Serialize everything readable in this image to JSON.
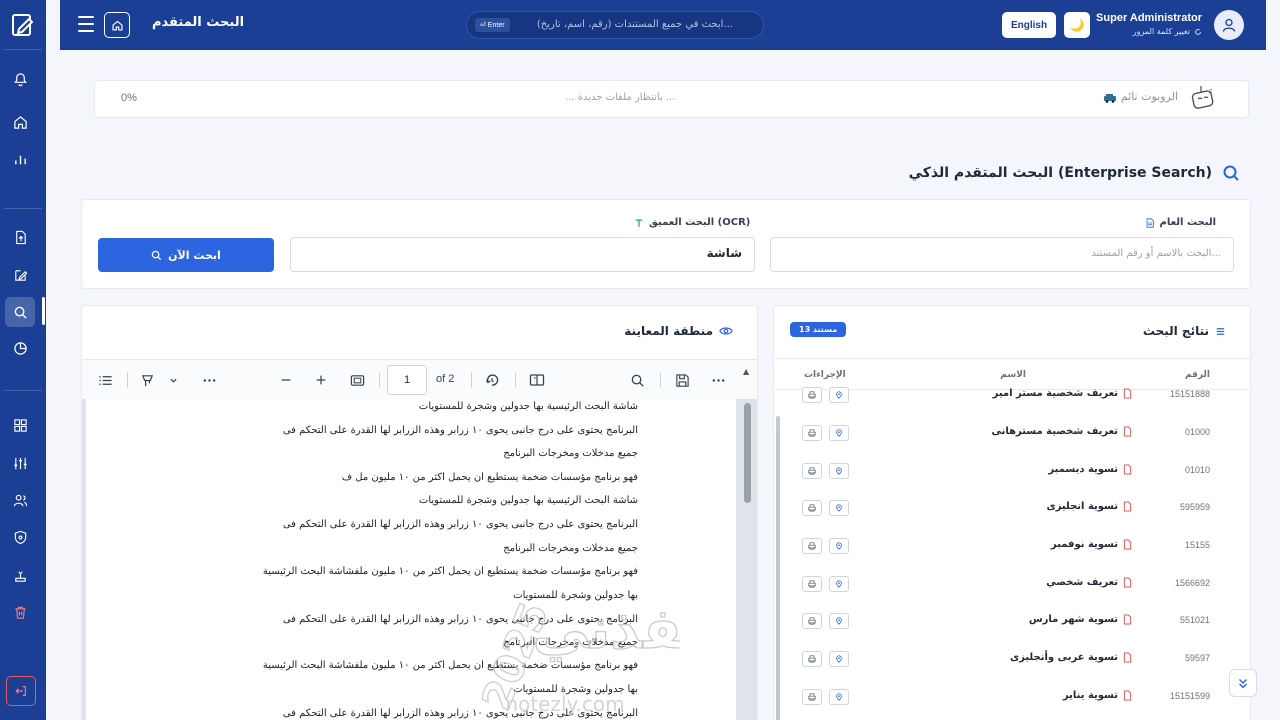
{
  "header": {
    "title": "البحث المتقدم",
    "search_placeholder": "ابحث في جميع المستندات (رقم، اسم، تاريخ)...",
    "enter_key": "⏎ Enter",
    "language_button": "English",
    "user_name": "Super Administrator",
    "change_password": "تغيير كلمة المرور"
  },
  "robot": {
    "status": "الروبوت نائم",
    "waiting_text": "... بانتظار ملفات جديدة ...",
    "progress_percent": "0%"
  },
  "page": {
    "title": "البحث المتقدم الذكي (Enterprise Search)"
  },
  "search": {
    "general_label": "البحث العام",
    "general_placeholder": "البحث بالاسم أو رقم المستند...",
    "deep_label": "البحث العميق (OCR)",
    "deep_value": "شاشة",
    "button_label": "ابحث الآن"
  },
  "preview": {
    "title": "منطقة المعاينة",
    "page_number": "1",
    "page_count_label": "of 2",
    "lines": [
      "شاشة البحث الرئيسية بها جدولين وشجرة للمستويات",
      "البرنامج يحتوى على درج جانبى يحوى ١٠ زرابر وهذه الزرابر لها القدرة على التحكم فى",
      "جميع مدخلات ومخرجات البرنامج",
      "فهو برنامج مؤسسات ضخمة يستطيع ان يحمل اكثر من ١٠ مليون مل ف",
      "شاشة البحث الرئيسية بها جدولين وشجرة للمستويات",
      "البرنامج يحتوى على درج جانبى يحوى ١٠ زرابر وهذه الزرابر لها القدرة على التحكم فى",
      "جميع مدخلات ومخرجات البرنامج",
      "فهو برنامج مؤسسات ضخمة يستطيع ان يحمل اكثر من ١٠ مليون ملفشاشة البحث الرئيسية",
      "بها جدولين وشجرة للمستويات",
      "البرنامج يحتوى على درج جانبى يحوى ١٠ زرابر وهذه الزرابر لها القدرة على التحكم فى",
      "جميع مدخلات ومخرجات البرنامج",
      "فهو برنامج مؤسسات ضخمة يستطيع ان يحمل اكثر من ١٠ مليون ملفشاشة البحث الرئيسية",
      "بها جدولين وشجرة للمستويات",
      "البرنامج يحتوى على درج جانبى يحوى ١٠ زرابر وهذه الزرابر لها القدرة على التحكم فى"
    ]
  },
  "results": {
    "title": "نتائج البحث",
    "count_badge": "13 مستند",
    "columns": {
      "number": "الرقم",
      "name": "الاسم",
      "actions": "الإجراءات"
    },
    "rows": [
      {
        "number": "15151888",
        "name": "تعريف شخصية مستر امير"
      },
      {
        "number": "01000",
        "name": "تعريف شخصية مسترهانى"
      },
      {
        "number": "01010",
        "name": "تسوية ديسمبر"
      },
      {
        "number": "595959",
        "name": "تسوية انجليزى"
      },
      {
        "number": "15155",
        "name": "تسوية نوفمبر"
      },
      {
        "number": "1566692",
        "name": "تعريف شخصي"
      },
      {
        "number": "551021",
        "name": "تسوية شهر مارس"
      },
      {
        "number": "59597",
        "name": "تسوية عربى وأنجليزى"
      },
      {
        "number": "15151599",
        "name": "تسوية يناير"
      }
    ]
  },
  "watermark": {
    "text_ar": "نفذني",
    "text_en": "notezly.com",
    "year": "2025"
  },
  "colors": {
    "primary": "#1b3f95",
    "accent": "#2d64e0",
    "danger": "#e05a5a"
  }
}
